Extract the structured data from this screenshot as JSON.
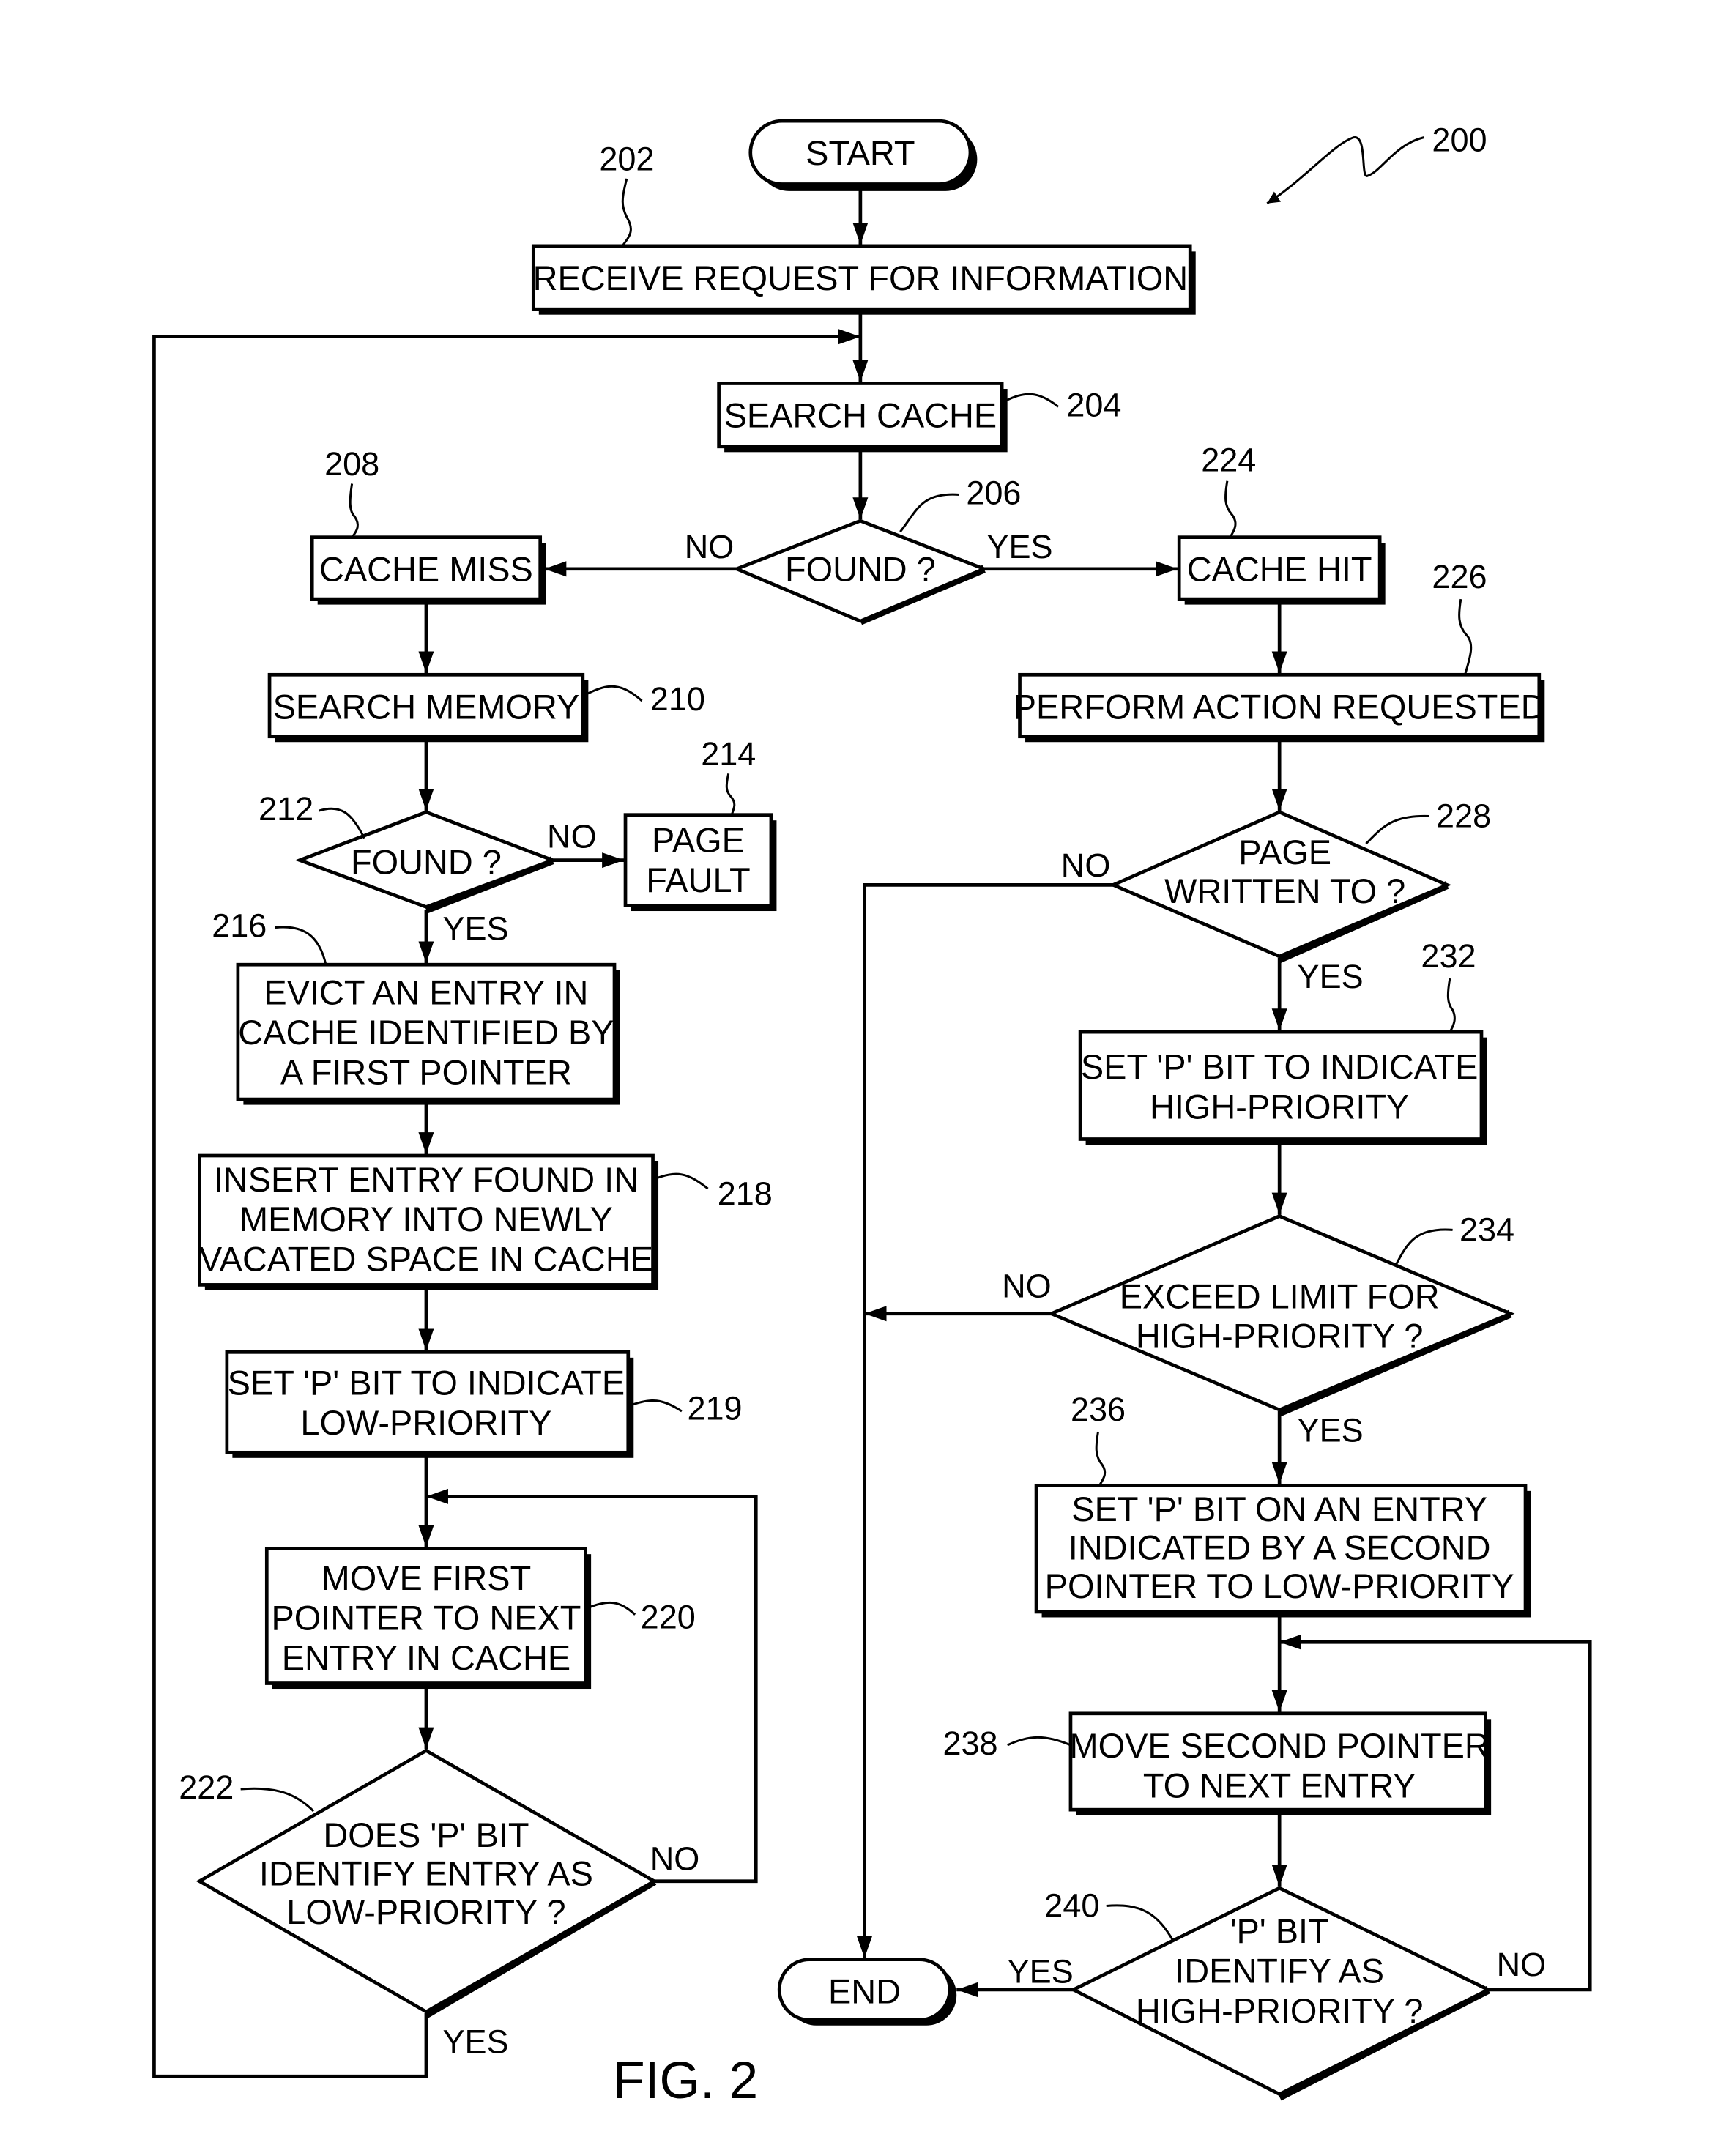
{
  "figure": {
    "caption": "FIG. 2",
    "reference": "200"
  },
  "nodes": {
    "start": {
      "type": "terminal",
      "label": "START"
    },
    "n202": {
      "type": "process",
      "ref": "202",
      "lines": [
        "RECEIVE REQUEST FOR INFORMATION"
      ]
    },
    "n204": {
      "type": "process",
      "ref": "204",
      "lines": [
        "SEARCH CACHE"
      ]
    },
    "n206": {
      "type": "decision",
      "ref": "206",
      "lines": [
        "FOUND ?"
      ]
    },
    "n208": {
      "type": "process",
      "ref": "208",
      "lines": [
        "CACHE MISS"
      ]
    },
    "n210": {
      "type": "process",
      "ref": "210",
      "lines": [
        "SEARCH MEMORY"
      ]
    },
    "n212": {
      "type": "decision",
      "ref": "212",
      "lines": [
        "FOUND ?"
      ]
    },
    "n214": {
      "type": "process",
      "ref": "214",
      "lines": [
        "PAGE",
        "FAULT"
      ]
    },
    "n216": {
      "type": "process",
      "ref": "216",
      "lines": [
        "EVICT AN ENTRY IN",
        "CACHE IDENTIFIED BY",
        "A FIRST POINTER"
      ]
    },
    "n218": {
      "type": "process",
      "ref": "218",
      "lines": [
        "INSERT ENTRY FOUND IN",
        "MEMORY INTO NEWLY",
        "VACATED SPACE IN CACHE"
      ]
    },
    "n219": {
      "type": "process",
      "ref": "219",
      "lines": [
        "SET 'P' BIT TO INDICATE",
        "LOW-PRIORITY"
      ]
    },
    "n220": {
      "type": "process",
      "ref": "220",
      "lines": [
        "MOVE FIRST",
        "POINTER TO NEXT",
        "ENTRY IN CACHE"
      ]
    },
    "n222": {
      "type": "decision",
      "ref": "222",
      "lines": [
        "DOES 'P' BIT",
        "IDENTIFY ENTRY AS",
        "LOW-PRIORITY ?"
      ]
    },
    "n224": {
      "type": "process",
      "ref": "224",
      "lines": [
        "CACHE HIT"
      ]
    },
    "n226": {
      "type": "process",
      "ref": "226",
      "lines": [
        "PERFORM ACTION REQUESTED"
      ]
    },
    "n228": {
      "type": "decision",
      "ref": "228",
      "lines": [
        "PAGE",
        "WRITTEN TO ?"
      ]
    },
    "n232": {
      "type": "process",
      "ref": "232",
      "lines": [
        "SET 'P' BIT TO INDICATE",
        "HIGH-PRIORITY"
      ]
    },
    "n234": {
      "type": "decision",
      "ref": "234",
      "lines": [
        "EXCEED LIMIT FOR",
        "HIGH-PRIORITY ?"
      ]
    },
    "n236": {
      "type": "process",
      "ref": "236",
      "lines": [
        "SET 'P' BIT ON AN ENTRY",
        "INDICATED BY A SECOND",
        "POINTER TO LOW-PRIORITY"
      ]
    },
    "n238": {
      "type": "process",
      "ref": "238",
      "lines": [
        "MOVE SECOND POINTER",
        "TO NEXT ENTRY"
      ]
    },
    "n240": {
      "type": "decision",
      "ref": "240",
      "lines": [
        "'P' BIT",
        "IDENTIFY AS",
        "HIGH-PRIORITY ?"
      ]
    },
    "end": {
      "type": "terminal",
      "label": "END"
    }
  },
  "edge_labels": {
    "n206_no": "NO",
    "n206_yes": "YES",
    "n212_no": "NO",
    "n212_yes": "YES",
    "n222_no": "NO",
    "n222_yes": "YES",
    "n228_no": "NO",
    "n228_yes": "YES",
    "n234_no": "NO",
    "n234_yes": "YES",
    "n240_no": "NO",
    "n240_yes": "YES"
  },
  "edges": [
    {
      "from": "start",
      "to": "n202"
    },
    {
      "from": "n202",
      "to": "n204"
    },
    {
      "from": "n204",
      "to": "n206"
    },
    {
      "from": "n206",
      "to": "n208",
      "label": "NO"
    },
    {
      "from": "n206",
      "to": "n224",
      "label": "YES"
    },
    {
      "from": "n208",
      "to": "n210"
    },
    {
      "from": "n210",
      "to": "n212"
    },
    {
      "from": "n212",
      "to": "n214",
      "label": "NO"
    },
    {
      "from": "n212",
      "to": "n216",
      "label": "YES"
    },
    {
      "from": "n216",
      "to": "n218"
    },
    {
      "from": "n218",
      "to": "n219"
    },
    {
      "from": "n219",
      "to": "n220"
    },
    {
      "from": "n220",
      "to": "n222"
    },
    {
      "from": "n222",
      "to": "n220",
      "label": "NO"
    },
    {
      "from": "n222",
      "to": "n204",
      "label": "YES"
    },
    {
      "from": "n224",
      "to": "n226"
    },
    {
      "from": "n226",
      "to": "n228"
    },
    {
      "from": "n228",
      "to": "end",
      "label": "NO"
    },
    {
      "from": "n228",
      "to": "n232",
      "label": "YES"
    },
    {
      "from": "n232",
      "to": "n234"
    },
    {
      "from": "n234",
      "to": "end",
      "label": "NO"
    },
    {
      "from": "n234",
      "to": "n236",
      "label": "YES"
    },
    {
      "from": "n236",
      "to": "n238"
    },
    {
      "from": "n238",
      "to": "n240"
    },
    {
      "from": "n240",
      "to": "n238",
      "label": "NO"
    },
    {
      "from": "n240",
      "to": "end",
      "label": "YES"
    }
  ]
}
